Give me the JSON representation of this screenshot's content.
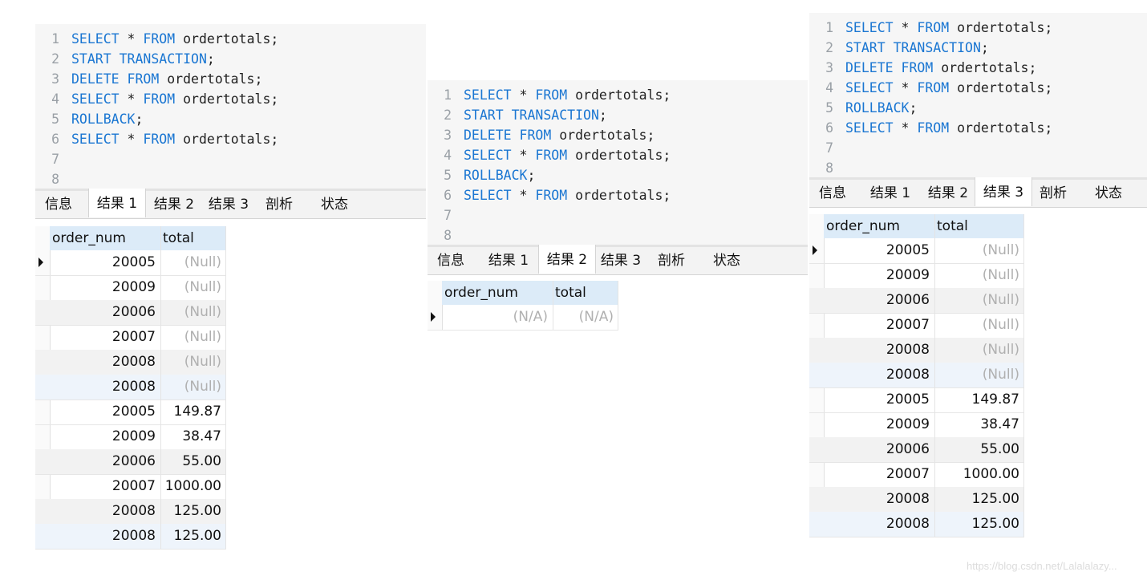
{
  "panels": [
    {
      "code_lines": [
        {
          "num": "1",
          "parts": [
            [
              "kw",
              "SELECT"
            ],
            [
              "t",
              " * "
            ],
            [
              "kw",
              "FROM"
            ],
            [
              "t",
              " ordertotals;"
            ]
          ]
        },
        {
          "num": "2",
          "parts": [
            [
              "kw",
              "START TRANSACTION"
            ],
            [
              "t",
              ";"
            ]
          ]
        },
        {
          "num": "3",
          "parts": [
            [
              "kw",
              "DELETE FROM"
            ],
            [
              "t",
              " ordertotals;"
            ]
          ]
        },
        {
          "num": "4",
          "parts": [
            [
              "kw",
              "SELECT"
            ],
            [
              "t",
              " * "
            ],
            [
              "kw",
              "FROM"
            ],
            [
              "t",
              " ordertotals;"
            ]
          ]
        },
        {
          "num": "5",
          "parts": [
            [
              "kw",
              "ROLLBACK"
            ],
            [
              "t",
              ";"
            ]
          ]
        },
        {
          "num": "6",
          "parts": [
            [
              "kw",
              "SELECT"
            ],
            [
              "t",
              " * "
            ],
            [
              "kw",
              "FROM"
            ],
            [
              "t",
              " ordertotals;"
            ]
          ]
        },
        {
          "num": "7",
          "parts": []
        },
        {
          "num": "8",
          "parts": []
        }
      ],
      "tabs": [
        "信息",
        "结果 1",
        "结果 2",
        "结果 3",
        "剖析",
        "状态"
      ],
      "active_tab": 1,
      "columns": [
        "order_num",
        "total"
      ],
      "rows": [
        [
          "20005",
          "(Null)"
        ],
        [
          "20009",
          "(Null)"
        ],
        [
          "20006",
          "(Null)"
        ],
        [
          "20007",
          "(Null)"
        ],
        [
          "20008",
          "(Null)"
        ],
        [
          "20008",
          "(Null)"
        ],
        [
          "20005",
          "149.87"
        ],
        [
          "20009",
          "38.47"
        ],
        [
          "20006",
          "55.00"
        ],
        [
          "20007",
          "1000.00"
        ],
        [
          "20008",
          "125.00"
        ],
        [
          "20008",
          "125.00"
        ]
      ]
    },
    {
      "code_lines": [
        {
          "num": "1",
          "parts": [
            [
              "kw",
              "SELECT"
            ],
            [
              "t",
              " * "
            ],
            [
              "kw",
              "FROM"
            ],
            [
              "t",
              " ordertotals;"
            ]
          ]
        },
        {
          "num": "2",
          "parts": [
            [
              "kw",
              "START TRANSACTION"
            ],
            [
              "t",
              ";"
            ]
          ]
        },
        {
          "num": "3",
          "parts": [
            [
              "kw",
              "DELETE FROM"
            ],
            [
              "t",
              " ordertotals;"
            ]
          ]
        },
        {
          "num": "4",
          "parts": [
            [
              "kw",
              "SELECT"
            ],
            [
              "t",
              " * "
            ],
            [
              "kw",
              "FROM"
            ],
            [
              "t",
              " ordertotals;"
            ]
          ]
        },
        {
          "num": "5",
          "parts": [
            [
              "kw",
              "ROLLBACK"
            ],
            [
              "t",
              ";"
            ]
          ]
        },
        {
          "num": "6",
          "parts": [
            [
              "kw",
              "SELECT"
            ],
            [
              "t",
              " * "
            ],
            [
              "kw",
              "FROM"
            ],
            [
              "t",
              " ordertotals;"
            ]
          ]
        },
        {
          "num": "7",
          "parts": []
        },
        {
          "num": "8",
          "parts": []
        }
      ],
      "tabs": [
        "信息",
        "结果 1",
        "结果 2",
        "结果 3",
        "剖析",
        "状态"
      ],
      "active_tab": 2,
      "columns": [
        "order_num",
        "total"
      ],
      "rows": [
        [
          "(N/A)",
          "(N/A)"
        ]
      ]
    },
    {
      "code_lines": [
        {
          "num": "1",
          "parts": [
            [
              "kw",
              "SELECT"
            ],
            [
              "t",
              " * "
            ],
            [
              "kw",
              "FROM"
            ],
            [
              "t",
              " ordertotals;"
            ]
          ]
        },
        {
          "num": "2",
          "parts": [
            [
              "kw",
              "START TRANSACTION"
            ],
            [
              "t",
              ";"
            ]
          ]
        },
        {
          "num": "3",
          "parts": [
            [
              "kw",
              "DELETE FROM"
            ],
            [
              "t",
              " ordertotals;"
            ]
          ]
        },
        {
          "num": "4",
          "parts": [
            [
              "kw",
              "SELECT"
            ],
            [
              "t",
              " * "
            ],
            [
              "kw",
              "FROM"
            ],
            [
              "t",
              " ordertotals;"
            ]
          ]
        },
        {
          "num": "5",
          "parts": [
            [
              "kw",
              "ROLLBACK"
            ],
            [
              "t",
              ";"
            ]
          ]
        },
        {
          "num": "6",
          "parts": [
            [
              "kw",
              "SELECT"
            ],
            [
              "t",
              " * "
            ],
            [
              "kw",
              "FROM"
            ],
            [
              "t",
              " ordertotals;"
            ]
          ]
        },
        {
          "num": "7",
          "parts": []
        },
        {
          "num": "8",
          "parts": []
        }
      ],
      "tabs": [
        "信息",
        "结果 1",
        "结果 2",
        "结果 3",
        "剖析",
        "状态"
      ],
      "active_tab": 3,
      "columns": [
        "order_num",
        "total"
      ],
      "rows": [
        [
          "20005",
          "(Null)"
        ],
        [
          "20009",
          "(Null)"
        ],
        [
          "20006",
          "(Null)"
        ],
        [
          "20007",
          "(Null)"
        ],
        [
          "20008",
          "(Null)"
        ],
        [
          "20008",
          "(Null)"
        ],
        [
          "20005",
          "149.87"
        ],
        [
          "20009",
          "38.47"
        ],
        [
          "20006",
          "55.00"
        ],
        [
          "20007",
          "1000.00"
        ],
        [
          "20008",
          "125.00"
        ],
        [
          "20008",
          "125.00"
        ]
      ]
    }
  ],
  "watermark": "https://blog.csdn.net/Lalalalazy..."
}
